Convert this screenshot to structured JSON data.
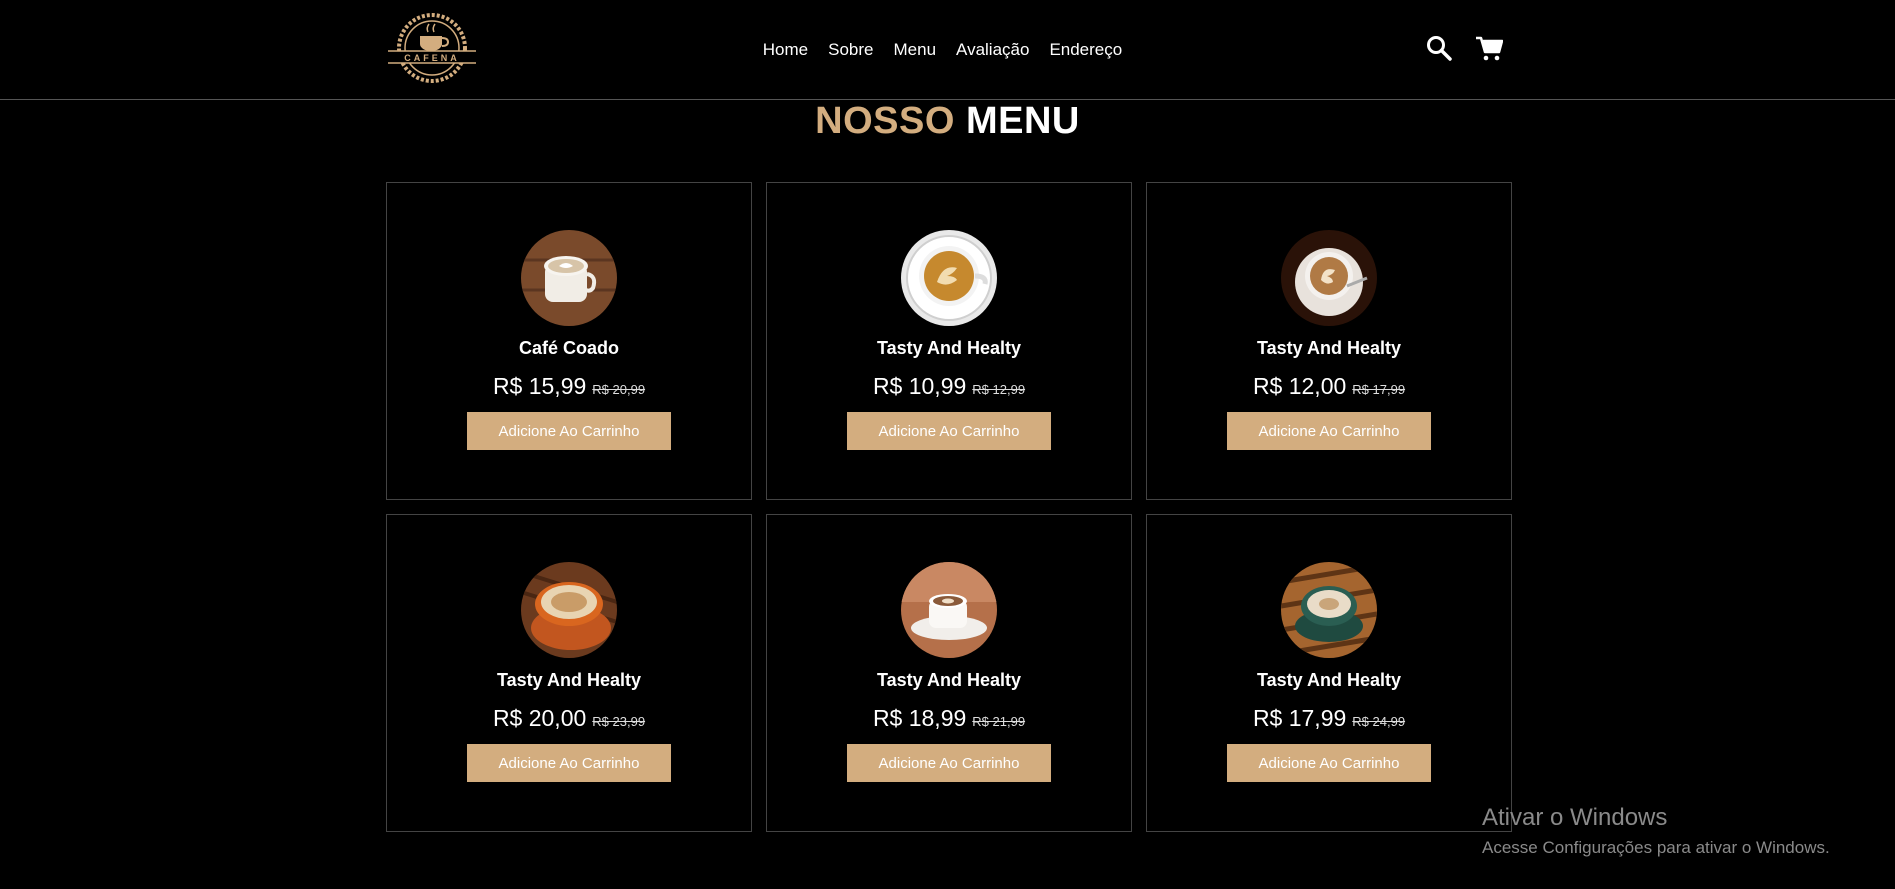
{
  "header": {
    "logo_text": "CAFENA",
    "nav": [
      "Home",
      "Sobre",
      "Menu",
      "Avaliação",
      "Endereço"
    ],
    "icons": [
      "search-icon",
      "cart-icon"
    ]
  },
  "section": {
    "title_accent": "NOSSO",
    "title_main": "MENU"
  },
  "products": [
    {
      "name": "Café Coado",
      "price": "R$ 15,99",
      "old_price": "R$ 20,99",
      "button": "Adicione Ao Carrinho"
    },
    {
      "name": "Tasty And Healty",
      "price": "R$ 10,99",
      "old_price": "R$ 12,99",
      "button": "Adicione Ao Carrinho"
    },
    {
      "name": "Tasty And Healty",
      "price": "R$ 12,00",
      "old_price": "R$ 17,99",
      "button": "Adicione Ao Carrinho"
    },
    {
      "name": "Tasty And Healty",
      "price": "R$ 20,00",
      "old_price": "R$ 23,99",
      "button": "Adicione Ao Carrinho"
    },
    {
      "name": "Tasty And Healty",
      "price": "R$ 18,99",
      "old_price": "R$ 21,99",
      "button": "Adicione Ao Carrinho"
    },
    {
      "name": "Tasty And Healty",
      "price": "R$ 17,99",
      "old_price": "R$ 24,99",
      "button": "Adicione Ao Carrinho"
    }
  ],
  "watermark": {
    "title": "Ativar o Windows",
    "subtitle": "Acesse Configurações para ativar o Windows."
  },
  "colors": {
    "accent": "#d3ad7f",
    "background": "#000000",
    "card_border": "#444444"
  }
}
